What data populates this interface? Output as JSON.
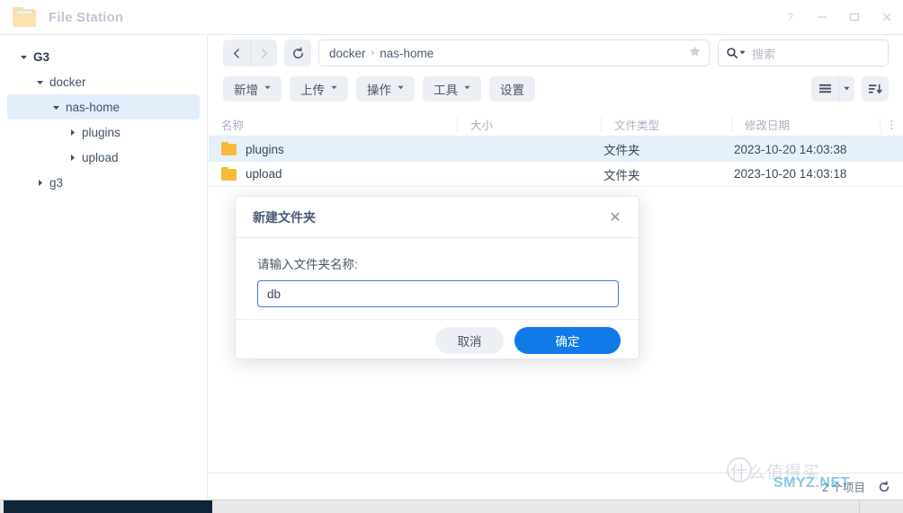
{
  "window": {
    "title": "File Station",
    "app_icon": "folder-icon",
    "controls": [
      {
        "name": "help-button",
        "glyph": "?"
      },
      {
        "name": "minimize-button",
        "glyph": "—"
      },
      {
        "name": "maximize-button",
        "glyph": "□"
      },
      {
        "name": "close-button",
        "glyph": "✕"
      }
    ]
  },
  "sidebar": {
    "items": [
      {
        "label": "G3",
        "indent": 10,
        "expanded": true,
        "selected": false,
        "root": true
      },
      {
        "label": "docker",
        "indent": 28,
        "expanded": true,
        "selected": false,
        "root": false
      },
      {
        "label": "nas-home",
        "indent": 46,
        "expanded": true,
        "selected": true,
        "root": false
      },
      {
        "label": "plugins",
        "indent": 64,
        "expanded": false,
        "selected": false,
        "root": false
      },
      {
        "label": "upload",
        "indent": 64,
        "expanded": false,
        "selected": false,
        "root": false
      },
      {
        "label": "g3",
        "indent": 28,
        "expanded": false,
        "selected": false,
        "root": false
      }
    ]
  },
  "nav": {
    "back": "back-icon",
    "forward": "forward-icon",
    "refresh": "refresh-icon",
    "breadcrumb": [
      "docker",
      "nas-home"
    ],
    "breadcrumb_separator": "›",
    "favorite": "star-icon"
  },
  "search": {
    "placeholder": "搜索",
    "icon": "search-icon"
  },
  "toolbar": {
    "buttons": [
      {
        "label": "新增",
        "caret": true,
        "name": "create-button"
      },
      {
        "label": "上传",
        "caret": true,
        "name": "upload-button"
      },
      {
        "label": "操作",
        "caret": true,
        "name": "action-button"
      },
      {
        "label": "工具",
        "caret": true,
        "name": "tools-button"
      },
      {
        "label": "设置",
        "caret": false,
        "name": "settings-button"
      }
    ],
    "view_mode": "list-view-icon",
    "sort": "sort-icon"
  },
  "filelist": {
    "columns": [
      "名称",
      "大小",
      "文件类型",
      "修改日期"
    ],
    "rows": [
      {
        "name": "plugins",
        "size": "",
        "type": "文件夹",
        "date": "2023-10-20 14:03:38",
        "selected": true
      },
      {
        "name": "upload",
        "size": "",
        "type": "文件夹",
        "date": "2023-10-20 14:03:18",
        "selected": false
      }
    ],
    "more_menu": "⋮"
  },
  "status": {
    "item_count": "2 个项目",
    "refresh": "refresh-icon"
  },
  "dialog": {
    "title": "新建文件夹",
    "close": "✕",
    "label": "请输入文件夹名称:",
    "input_value": "db",
    "input_placeholder": "",
    "cancel_label": "取消",
    "confirm_label": "确定"
  },
  "watermark": {
    "cn": "什么值得买",
    "net": "SMYZ.NET"
  },
  "colors": {
    "accent": "#127ae8",
    "selection": "#e6f0fb",
    "folder": "#f9b938",
    "toolbar_button": "#eceff4",
    "watermark_blue": "#1ea0d8"
  }
}
